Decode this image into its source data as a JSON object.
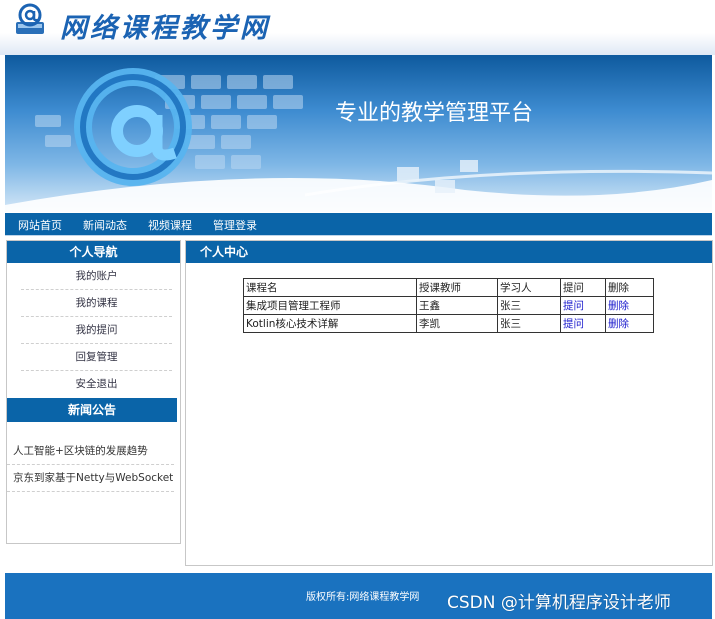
{
  "header": {
    "site_title": "网络课程教学网",
    "logo_icon": "at-sign-folder-icon"
  },
  "banner": {
    "slogan": "专业的教学管理平台"
  },
  "topnav": {
    "items": [
      "网站首页",
      "新闻动态",
      "视频课程",
      "管理登录"
    ]
  },
  "sidebar": {
    "title": "个人导航",
    "links": [
      "我的账户",
      "我的课程",
      "我的提问",
      "回复管理",
      "安全退出"
    ],
    "news_title": "新闻公告",
    "news": [
      "人工智能+区块链的发展趋势",
      "京东到家基于Netty与WebSocket"
    ]
  },
  "main": {
    "title": "个人中心",
    "table": {
      "headers": [
        "课程名",
        "授课教师",
        "学习人",
        "提问",
        "删除"
      ],
      "rows": [
        [
          "集成项目管理工程师",
          "王鑫",
          "张三",
          "提问",
          "删除"
        ],
        [
          "Kotlin核心技术详解",
          "李凯",
          "张三",
          "提问",
          "删除"
        ]
      ]
    }
  },
  "footer": {
    "copyright": "版权所有:网络课程教学网"
  },
  "watermark": "CSDN @计算机程序设计老师",
  "colors": {
    "nav_blue": "#0a64a8",
    "footer_blue": "#1a72bf",
    "link_blue": "#1a1acc",
    "title_blue": "#1b63b3"
  }
}
